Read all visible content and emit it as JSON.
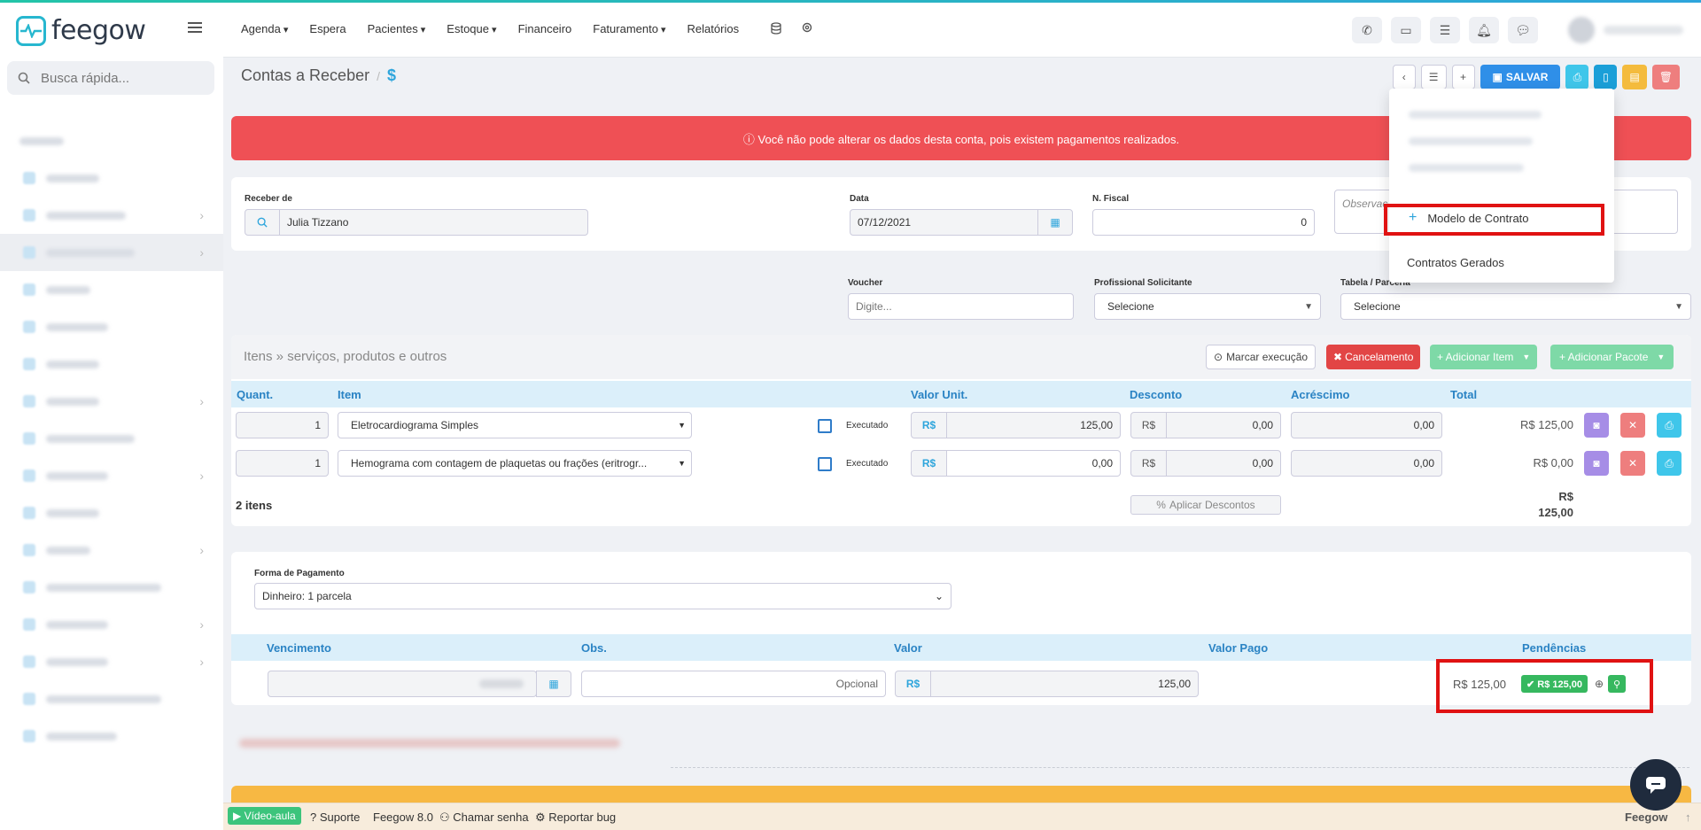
{
  "brand": {
    "name": "feegow"
  },
  "sidebar": {
    "search_placeholder": "Busca rápida..."
  },
  "nav": {
    "items": [
      "Agenda",
      "Espera",
      "Pacientes",
      "Estoque",
      "Financeiro",
      "Faturamento",
      "Relatórios"
    ],
    "caret_items": [
      true,
      false,
      true,
      true,
      false,
      true,
      false
    ]
  },
  "header": {
    "title": "Contas a Receber",
    "sep": "/",
    "icon": "$"
  },
  "toolbar": {
    "save_label": "SALVAR"
  },
  "alert": {
    "text": "ⓘ Você não pode alterar os dados desta conta, pois existem pagamentos realizados."
  },
  "form": {
    "receber_label": "Receber de",
    "receber_value": "Julia Tizzano",
    "data_label": "Data",
    "data_value": "07/12/2021",
    "nfiscal_label": "N. Fiscal",
    "nfiscal_value": "0",
    "obs_placeholder": "Observaç",
    "voucher_label": "Voucher",
    "voucher_placeholder": "Digite...",
    "prof_label": "Profissional Solicitante",
    "prof_value": "Selecione",
    "tabela_label": "Tabela / Parceria",
    "tabela_value": "Selecione"
  },
  "items_section": {
    "title": "Itens » serviços, produtos e outros",
    "marcar": "Marcar execução",
    "cancelamento": "Cancelamento",
    "adicionar_item": "+ Adicionar Item",
    "adicionar_pacote": "+ Adicionar Pacote",
    "headers": [
      "Quant.",
      "Item",
      "Valor Unit.",
      "Desconto",
      "Acréscimo",
      "Total"
    ],
    "rows": [
      {
        "qty": "1",
        "item": "Eletrocardiograma Simples",
        "exec": "Executado",
        "cur": "R$",
        "unit": "125,00",
        "disc_cur": "R$",
        "disc": "0,00",
        "acres": "0,00",
        "total": "R$ 125,00"
      },
      {
        "qty": "1",
        "item": "Hemograma com contagem de plaquetas ou frações (eritrogr...",
        "exec": "Executado",
        "cur": "R$",
        "unit": "0,00",
        "disc_cur": "R$",
        "disc": "0,00",
        "acres": "0,00",
        "total": "R$ 0,00"
      }
    ],
    "count": "2 itens",
    "aplicar": "Aplicar Descontos",
    "sum_cur": "R$",
    "sum_val": "125,00"
  },
  "payment": {
    "forma_label": "Forma de Pagamento",
    "forma_value": "Dinheiro: 1 parcela",
    "headers": [
      "Vencimento",
      "Obs.",
      "Valor",
      "Valor Pago",
      "Pendências"
    ],
    "obs_placeholder": "Opcional",
    "cur": "R$",
    "valor": "125,00",
    "valor_pago": "R$ 125,00",
    "badge": "✔ R$ 125,00"
  },
  "dropdown": {
    "modelo": "Modelo de Contrato",
    "gerados": "Contratos Gerados"
  },
  "footer": {
    "video": "Vídeo-aula",
    "suporte": "Suporte",
    "version": "Feegow 8.0",
    "chamar": "Chamar senha",
    "reportar": "Reportar bug",
    "brand": "Feegow"
  }
}
